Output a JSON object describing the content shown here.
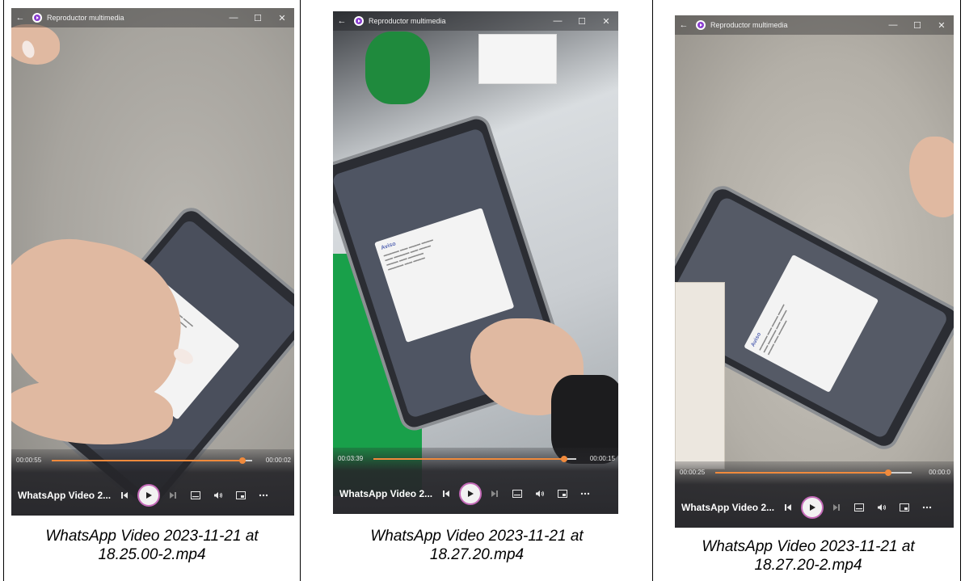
{
  "player": {
    "app_title": "Reproductor multimedia",
    "back_glyph": "←",
    "minimize_glyph": "—",
    "maximize_glyph": "☐",
    "close_glyph": "✕"
  },
  "dialog": {
    "title": "Aviso"
  },
  "panels": [
    {
      "video_title": "WhatsApp Video 2...",
      "elapsed": "00:00:55",
      "remaining": "00:00:02",
      "progress": 0.95,
      "caption_line1": "WhatsApp Video 2023-11-21 at",
      "caption_line2": "18.25.00-2.mp4"
    },
    {
      "video_title": "WhatsApp Video 2...",
      "elapsed": "00:03:39",
      "remaining": "00:00:15",
      "progress": 0.94,
      "caption_line1": "WhatsApp Video 2023-11-21 at",
      "caption_line2": "18.27.20.mp4"
    },
    {
      "video_title": "WhatsApp Video 2...",
      "elapsed": "00:00:25",
      "remaining": "00:00:0",
      "progress": 0.88,
      "caption_line1": "WhatsApp Video 2023-11-21 at",
      "caption_line2": "18.27.20-2.mp4"
    }
  ],
  "icons": {
    "prev": "skip-previous-icon",
    "play": "play-icon",
    "next": "skip-next-icon",
    "subtitles": "subtitles-icon",
    "volume": "volume-icon",
    "miniplayer": "miniplayer-icon",
    "more": "more-icon"
  },
  "colors": {
    "accent": "#f08a3c",
    "play_ring": "#c46ab8",
    "controls_bg": "#26262a"
  }
}
